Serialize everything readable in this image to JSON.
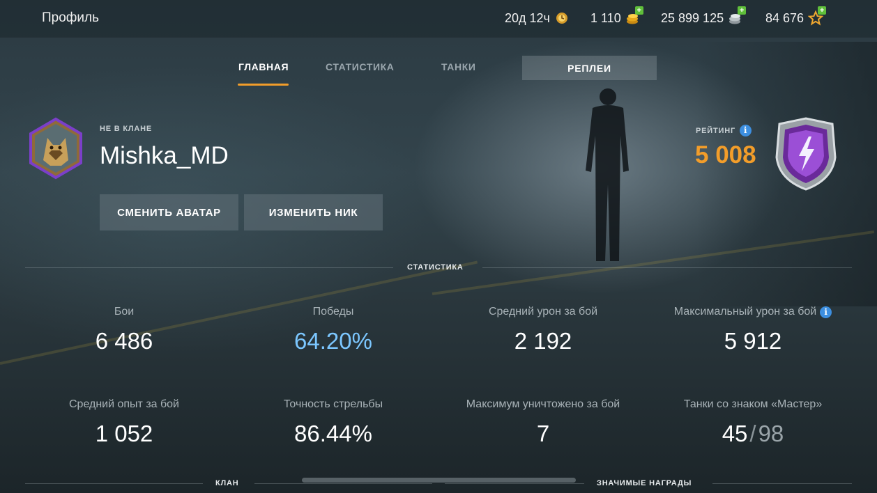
{
  "topbar": {
    "title": "Профиль",
    "premium_time": "20д 12ч",
    "gold": "1 110",
    "credits": "25 899 125",
    "free_xp": "84 676"
  },
  "tabs": {
    "main": "ГЛАВНАЯ",
    "statistics": "СТАТИСТИКА",
    "tanks": "ТАНКИ",
    "replays": "РЕПЛЕИ"
  },
  "profile": {
    "clan_status": "НЕ В КЛАНЕ",
    "nickname": "Mishka_MD",
    "change_avatar": "СМЕНИТЬ АВАТАР",
    "change_nick": "ИЗМЕНИТЬ НИК",
    "rating_label": "РЕЙТИНГ",
    "rating_value": "5 008"
  },
  "sections": {
    "statistics": "СТАТИСТИКА",
    "clan": "КЛАН",
    "awards": "ЗНАЧИМЫЕ НАГРАДЫ"
  },
  "stats": {
    "battles": {
      "label": "Бои",
      "value": "6 486"
    },
    "victories": {
      "label": "Победы",
      "value": "64.20%"
    },
    "avg_damage": {
      "label": "Средний урон за бой",
      "value": "2 192"
    },
    "max_damage": {
      "label": "Максимальный урон за бой",
      "value": "5 912"
    },
    "avg_xp": {
      "label": "Средний опыт за бой",
      "value": "1 052"
    },
    "accuracy": {
      "label": "Точность стрельбы",
      "value": "86.44%"
    },
    "max_kills": {
      "label": "Максимум уничтожено за бой",
      "value": "7"
    },
    "master_tanks": {
      "label": "Танки со знаком «Мастер»",
      "value": "45",
      "separator": "/",
      "total": "98"
    }
  },
  "colors": {
    "accent": "#f29d2a",
    "victories": "#7cc7ff",
    "info": "#3d8fe0",
    "plus": "#5fbf3a"
  },
  "icons": {
    "premium": "premium-clock-icon",
    "gold": "gold-coins-icon",
    "credits": "silver-coins-icon",
    "free_xp": "star-xp-icon"
  }
}
